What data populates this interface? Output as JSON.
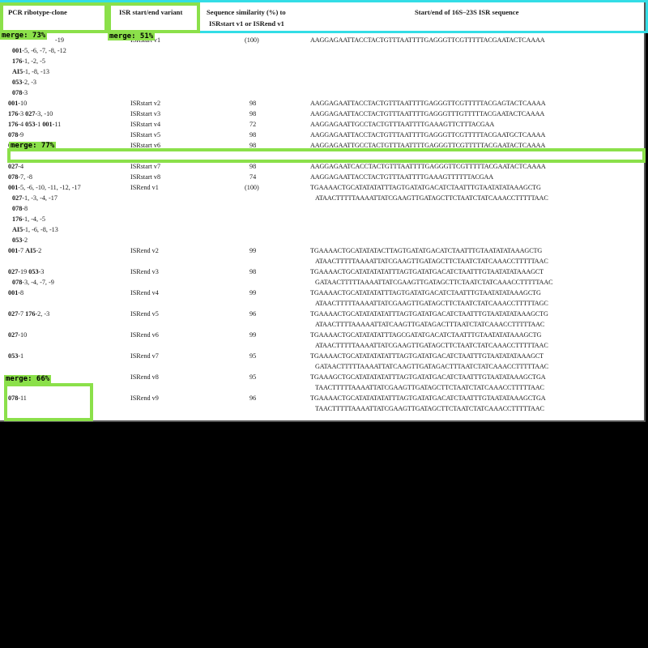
{
  "header": {
    "col1": "PCR ribotype-clone",
    "col2": "ISR start/end variant",
    "col3_line1": "Sequence similarity (%) to",
    "col3_line2": "ISRstart v1 or ISRend v1",
    "col4": "Start/end of 16S–23S ISR sequence"
  },
  "rows": [
    {
      "ribo": [
        "-19",
        "001-5, -6, -7, -8, -12",
        "176-1, -2, -5",
        "AI5-1, -8, -13",
        "053-2, -3",
        "078-3"
      ],
      "variant": "ISRstart v1",
      "similarity": "(100)",
      "seq": [
        "AAGGAGAATTACCTACTGTTTAATTTTGAGGGTTCGTTTTTACGAATACTCAAAA"
      ]
    },
    {
      "ribo": [
        "001-10"
      ],
      "variant": "ISRstart v2",
      "similarity": "98",
      "seq": [
        "AAGGAGAATTACCTACTGTTTAATTTTGAGGGTTCGTTTTTACGAGTACTCAAAA"
      ]
    },
    {
      "ribo": [
        "176-3 027-3, -10"
      ],
      "variant": "ISRstart v3",
      "similarity": "98",
      "seq": [
        "AAGGAGAATTACCTACTGTTTAATTTTGAGGGTTTGTTTTTACGAATACTCAAAA"
      ]
    },
    {
      "ribo": [
        "176-4 053-1 001-11"
      ],
      "variant": "ISRstart v4",
      "similarity": "72",
      "seq": [
        "AAGGAGAATTGCCTACTGTTTAATTTTGAAAGTTCTTTACGAA"
      ]
    },
    {
      "ribo": [
        "078-9"
      ],
      "variant": "ISRstart v5",
      "similarity": "98",
      "seq": [
        "AAGGAGAATTACCTACTGTTTAATTTTGAGGGTTCGTTTTTACGAATGCTCAAAA"
      ]
    },
    {
      "ribo": [
        "078-4, -5, -11"
      ],
      "variant": "ISRstart v6",
      "similarity": "98",
      "seq": [
        "AAGGAGAATTGCCTACTGTTTAATTTTGAGGGTTCGTTTTTACGAATACTCAAAA"
      ]
    },
    {
      "ribo": [
        "027-4"
      ],
      "variant": "ISRstart v7",
      "similarity": "98",
      "seq": [
        "AAGGAGAATCACCTACTGTTTAATTTTGAGGGTTCGTTTTTACGAATACTCAAAA"
      ]
    },
    {
      "ribo": [
        "078-7, -8"
      ],
      "variant": "ISRstart v8",
      "similarity": "74",
      "seq": [
        "AAGGAGAATTACCTACTGTTTAATTTTGAAAGTTTTTTACGAA"
      ]
    },
    {
      "ribo": [
        "001-5, -6, -10, -11, -12, -17",
        "027-1, -3, -4, -17",
        "078-8",
        "176-1, -4, -5",
        "AI5-1, -6, -8, -13",
        "053-2"
      ],
      "variant": "ISRend v1",
      "similarity": "(100)",
      "seq": [
        "TGAAAACTGCATATATATTTAGTGATATGACATCTAATTTGTAATATATAAAGCTG",
        "ATAACTTTTTAAAATTATCGAAGTTGATAGCTTCTAATCTATCAAACCTTTTTAAC"
      ]
    },
    {
      "ribo": [
        "001-7 AI5-2"
      ],
      "variant": "ISRend v2",
      "similarity": "99",
      "seq": [
        "TGAAAACTGCATATATACTTAGTGATATGACATCTAATTTGTAATATATAAAGCTG",
        "ATAACTTTTTAAAATTATCGAAGTTGATAGCTTCTAATCTATCAAACCTTTTTAAC"
      ]
    },
    {
      "ribo": [
        "027-19 053-3",
        "078-3, -4, -7, -9"
      ],
      "variant": "ISRend v3",
      "similarity": "98",
      "seq": [
        "TGAAAACTGCATATATATATTTAGTGATATGACATCTAATTTGTAATATATAAAGCT",
        "GATAACTTTTTAAAATTATCGAAGTTGATAGCTTCTAATCTATCAAACCTTTTTAAC"
      ]
    },
    {
      "ribo": [
        "001-8"
      ],
      "variant": "ISRend v4",
      "similarity": "99",
      "seq": [
        "TGAAAACTGCATATATATTTAGTGATATGACATCTAATTTGTAATATATAAAGCTG",
        "ATAACTTTTTAAAATTATCGAAGTTGATAGCTTCTAATCTATCAAACCTTTTTAGC"
      ]
    },
    {
      "ribo": [
        "027-7 176-2, -3"
      ],
      "variant": "ISRend v5",
      "similarity": "96",
      "seq": [
        "TGAAAACTGCATATATATATTTAGTGATATGACATCTAATTTGTAATATATAAAGCTG",
        "ATAACTTTTAAAAATTATCAAGTTGATAGACTTTAATCTATCAAACCTTTTTAAC"
      ]
    },
    {
      "ribo": [
        "027-10"
      ],
      "variant": "ISRend v6",
      "similarity": "99",
      "seq": [
        "TGAAAACTGCATATATATTTAGCGATATGACATCTAATTTGTAATATATAAAGCTG",
        "ATAACTTTTTAAAATTATCGAAGTTGATAGCTTCTAATCTATCAAACCTTTTTAAC"
      ]
    },
    {
      "ribo": [
        "053-1"
      ],
      "variant": "ISRend v7",
      "similarity": "95",
      "seq": [
        "TGAAAACTGCATATATATATTTAGTGATATGACATCTAATTTGTAATATATAAAGCT",
        "GATAACTTTTTAAAATTATCAAGTTGATAGACTTTAATCTATCAAACCTTTTTAAC"
      ]
    },
    {
      "ribo": [
        ""
      ],
      "variant": "ISRend v8",
      "similarity": "95",
      "seq": [
        "TGAAAGCTGCATATATATATTTAGTGATATGACATCTAATTTGTAATATAAAGCTGA",
        "TAACTTTTTAAAATTATCGAAGTTGATAGCTTCTAATCTATCAAACCTTTTTAAC"
      ]
    },
    {
      "ribo": [
        "078-11"
      ],
      "variant": "ISRend v9",
      "similarity": "96",
      "seq": [
        "TGAAAACTGCATATATATATTTAGTGATATGACATCTAATTTGTAATATAAAGCTGA",
        "TAACTTTTTAAAATTATCGAAGTTGATAGCTTCTAATCTATCAAACCTTTTTAAC"
      ]
    }
  ],
  "overlays": [
    {
      "label": "merge: 73%",
      "color": "#8be04a"
    },
    {
      "label": "merge: 51%",
      "color": "#8be04a"
    },
    {
      "label": "merge: 77%",
      "color": "#8be04a"
    },
    {
      "label": "merge: 66%",
      "color": "#8be04a"
    }
  ],
  "colors": {
    "highlight_green": "#8be04a",
    "highlight_cyan": "#33dde6",
    "background": "#000000"
  }
}
